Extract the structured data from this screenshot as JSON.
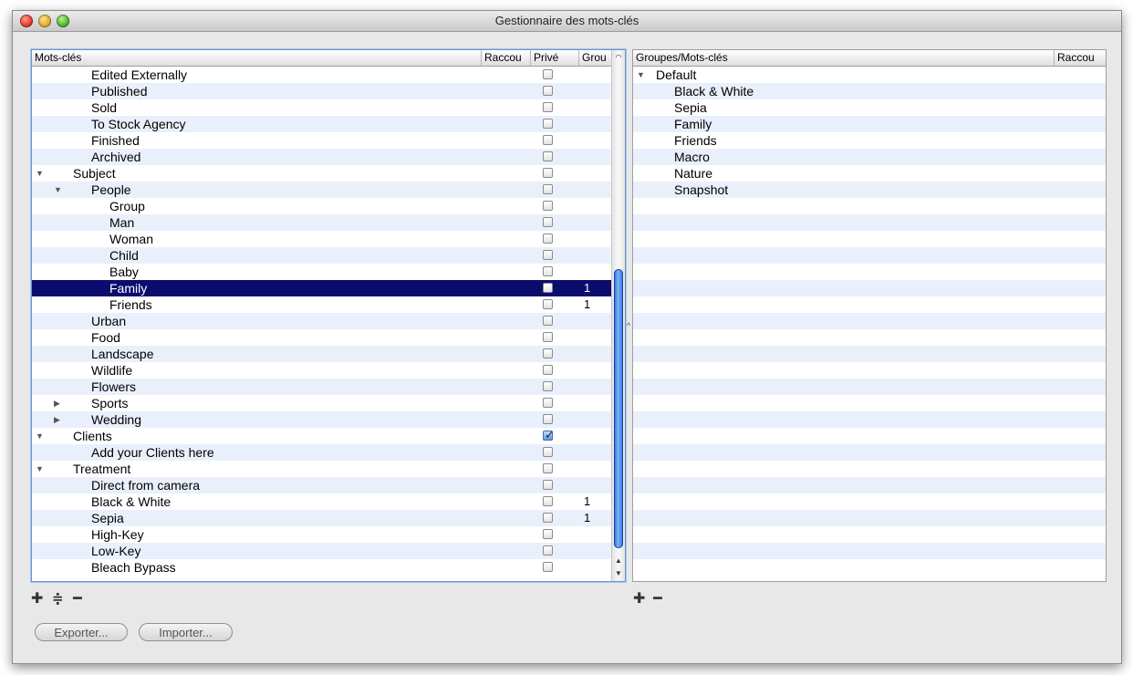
{
  "window": {
    "title": "Gestionnaire des mots-clés"
  },
  "left_table": {
    "columns": [
      "Mots-clés",
      "Raccou",
      "Privé",
      "Grou"
    ],
    "rows": [
      {
        "label": "Edited Externally",
        "indent": 1,
        "tri": "",
        "checked": false,
        "group": "",
        "selected": false
      },
      {
        "label": "Published",
        "indent": 1,
        "tri": "",
        "checked": false,
        "group": "",
        "selected": false
      },
      {
        "label": "Sold",
        "indent": 1,
        "tri": "",
        "checked": false,
        "group": "",
        "selected": false
      },
      {
        "label": "To Stock Agency",
        "indent": 1,
        "tri": "",
        "checked": false,
        "group": "",
        "selected": false
      },
      {
        "label": "Finished",
        "indent": 1,
        "tri": "",
        "checked": false,
        "group": "",
        "selected": false
      },
      {
        "label": "Archived",
        "indent": 1,
        "tri": "",
        "checked": false,
        "group": "",
        "selected": false
      },
      {
        "label": "Subject",
        "indent": 0,
        "tri": "down",
        "checked": false,
        "group": "",
        "selected": false
      },
      {
        "label": "People",
        "indent": 1,
        "tri": "down",
        "checked": false,
        "group": "",
        "selected": false
      },
      {
        "label": "Group",
        "indent": 2,
        "tri": "",
        "checked": false,
        "group": "",
        "selected": false
      },
      {
        "label": "Man",
        "indent": 2,
        "tri": "",
        "checked": false,
        "group": "",
        "selected": false
      },
      {
        "label": "Woman",
        "indent": 2,
        "tri": "",
        "checked": false,
        "group": "",
        "selected": false
      },
      {
        "label": "Child",
        "indent": 2,
        "tri": "",
        "checked": false,
        "group": "",
        "selected": false
      },
      {
        "label": "Baby",
        "indent": 2,
        "tri": "",
        "checked": false,
        "group": "",
        "selected": false
      },
      {
        "label": "Family",
        "indent": 2,
        "tri": "",
        "checked": false,
        "group": "1",
        "selected": true
      },
      {
        "label": "Friends",
        "indent": 2,
        "tri": "",
        "checked": false,
        "group": "1",
        "selected": false
      },
      {
        "label": "Urban",
        "indent": 1,
        "tri": "",
        "checked": false,
        "group": "",
        "selected": false
      },
      {
        "label": "Food",
        "indent": 1,
        "tri": "",
        "checked": false,
        "group": "",
        "selected": false
      },
      {
        "label": "Landscape",
        "indent": 1,
        "tri": "",
        "checked": false,
        "group": "",
        "selected": false
      },
      {
        "label": "Wildlife",
        "indent": 1,
        "tri": "",
        "checked": false,
        "group": "",
        "selected": false
      },
      {
        "label": "Flowers",
        "indent": 1,
        "tri": "",
        "checked": false,
        "group": "",
        "selected": false
      },
      {
        "label": "Sports",
        "indent": 1,
        "tri": "right",
        "checked": false,
        "group": "",
        "selected": false
      },
      {
        "label": "Wedding",
        "indent": 1,
        "tri": "right",
        "checked": false,
        "group": "",
        "selected": false
      },
      {
        "label": "Clients",
        "indent": 0,
        "tri": "down",
        "checked": true,
        "group": "",
        "selected": false
      },
      {
        "label": "Add your Clients here",
        "indent": 1,
        "tri": "",
        "checked": false,
        "group": "",
        "selected": false
      },
      {
        "label": "Treatment",
        "indent": 0,
        "tri": "down",
        "checked": false,
        "group": "",
        "selected": false
      },
      {
        "label": "Direct from camera",
        "indent": 1,
        "tri": "",
        "checked": false,
        "group": "",
        "selected": false
      },
      {
        "label": "Black & White",
        "indent": 1,
        "tri": "",
        "checked": false,
        "group": "1",
        "selected": false
      },
      {
        "label": "Sepia",
        "indent": 1,
        "tri": "",
        "checked": false,
        "group": "1",
        "selected": false
      },
      {
        "label": "High-Key",
        "indent": 1,
        "tri": "",
        "checked": false,
        "group": "",
        "selected": false
      },
      {
        "label": "Low-Key",
        "indent": 1,
        "tri": "",
        "checked": false,
        "group": "",
        "selected": false
      },
      {
        "label": "Bleach Bypass",
        "indent": 1,
        "tri": "",
        "checked": false,
        "group": "",
        "selected": false
      }
    ],
    "scroll_position": 0.45
  },
  "right_table": {
    "columns": [
      "Groupes/Mots-clés",
      "Raccou"
    ],
    "rows": [
      {
        "label": "Default",
        "indent": 0,
        "tri": "down"
      },
      {
        "label": "Black & White",
        "indent": 1,
        "tri": ""
      },
      {
        "label": "Sepia",
        "indent": 1,
        "tri": ""
      },
      {
        "label": "Family",
        "indent": 1,
        "tri": ""
      },
      {
        "label": "Friends",
        "indent": 1,
        "tri": ""
      },
      {
        "label": "Macro",
        "indent": 1,
        "tri": ""
      },
      {
        "label": "Nature",
        "indent": 1,
        "tri": ""
      },
      {
        "label": "Snapshot",
        "indent": 1,
        "tri": ""
      }
    ],
    "empty_rows": 22
  },
  "toolbar_left": {
    "add_icon": "plus-icon",
    "add_sub_icon": "add-subitem-icon",
    "remove_icon": "minus-icon"
  },
  "toolbar_right": {
    "add_icon": "plus-icon",
    "remove_icon": "minus-icon"
  },
  "buttons": {
    "export": "Exporter...",
    "import": "Importer..."
  },
  "colors": {
    "selection": "#0a0d6e",
    "stripe": "#e9f0fb",
    "scroll_thumb": "#2a6fe0"
  }
}
